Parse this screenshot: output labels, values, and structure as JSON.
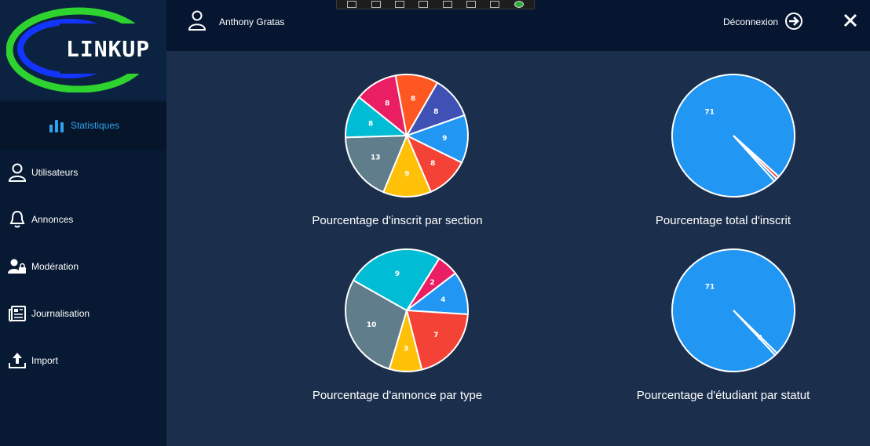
{
  "app": {
    "logo_text": "LINKUP"
  },
  "toolbar": {
    "icons": [
      "select-icon",
      "frame-icon",
      "cursor-icon",
      "window-icon",
      "cursor2-icon",
      "cut-icon",
      "text-icon",
      "check-icon"
    ]
  },
  "header": {
    "user_name": "Anthony Gratas",
    "logout_label": "Déconnexion"
  },
  "sidebar": {
    "items": [
      {
        "label": "Statistiques",
        "icon": "bar-chart-icon",
        "active": true
      },
      {
        "label": "Utilisateurs",
        "icon": "user-icon",
        "active": false
      },
      {
        "label": "Annonces",
        "icon": "bell-icon",
        "active": false
      },
      {
        "label": "Modération",
        "icon": "user-lock-icon",
        "active": false
      },
      {
        "label": "Journalisation",
        "icon": "newspaper-icon",
        "active": false
      },
      {
        "label": "Import",
        "icon": "upload-icon",
        "active": false
      }
    ]
  },
  "colors": {
    "accent": "#2fa3f2",
    "background": "#1b2e4b",
    "sidebar": "#081a33"
  },
  "chart_data": [
    {
      "type": "pie",
      "title": "Pourcentage d'inscrit par section",
      "values": [
        8,
        9,
        8,
        9,
        13,
        8,
        8,
        8
      ],
      "labels": [
        "8",
        "9",
        "8",
        "9",
        "13",
        "8",
        "8",
        "8"
      ],
      "colors": [
        "#3f51b5",
        "#2196f3",
        "#f44336",
        "#ffc107",
        "#607d8b",
        "#00bcd4",
        "#e91e63",
        "#ff5722"
      ]
    },
    {
      "type": "pie",
      "title": "Pourcentage total d'inscrit",
      "values": [
        71,
        0.6,
        0.6
      ],
      "labels": [
        "71",
        "",
        ""
      ],
      "colors": [
        "#2196f3",
        "#f44336",
        "#2196f3"
      ]
    },
    {
      "type": "pie",
      "title": "Pourcentage d'annonce par type",
      "values": [
        2,
        4,
        7,
        3,
        10,
        9
      ],
      "labels": [
        "2",
        "4",
        "7",
        "3",
        "10",
        "9"
      ],
      "colors": [
        "#e91e63",
        "#2196f3",
        "#f44336",
        "#ffc107",
        "#607d8b",
        "#00bcd4"
      ]
    },
    {
      "type": "pie",
      "title": "Pourcentage d'étudiant par statut",
      "values": [
        71,
        0.5
      ],
      "labels": [
        "71",
        "0"
      ],
      "colors": [
        "#2196f3",
        "#2196f3"
      ]
    }
  ]
}
